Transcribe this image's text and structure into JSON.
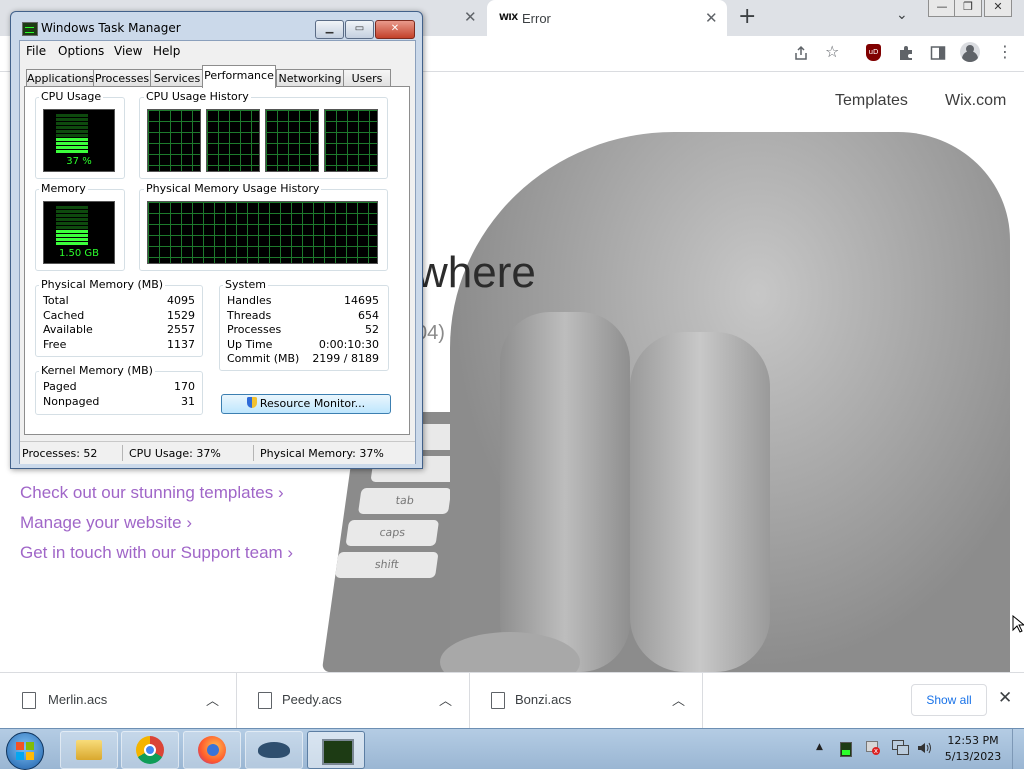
{
  "browser": {
    "tabs": [
      {
        "title": "Error",
        "favicon": "WIX"
      }
    ],
    "new_tab": "+",
    "window_controls": [
      "—",
      "❐",
      "✕"
    ]
  },
  "page": {
    "nav": [
      "Templates",
      "Wix.com"
    ],
    "heading_fragment": "where",
    "subheading_fragment": "04)",
    "links": [
      "Check out our stunning templates ›",
      "Manage your website ›",
      "Get in touch with our Support team ›"
    ],
    "link_color": "#a066c8",
    "keyboard_keys": [
      "tab",
      "caps",
      "shift"
    ]
  },
  "downloads": {
    "items": [
      {
        "name": "Merlin.acs"
      },
      {
        "name": "Peedy.acs"
      },
      {
        "name": "Bonzi.acs"
      }
    ],
    "show_all": "Show all"
  },
  "task_manager": {
    "title": "Windows Task Manager",
    "menu": [
      "File",
      "Options",
      "View",
      "Help"
    ],
    "tabs": [
      "Applications",
      "Processes",
      "Services",
      "Performance",
      "Networking",
      "Users"
    ],
    "active_tab": "Performance",
    "cpu_usage": {
      "label": "CPU Usage",
      "value": "37 %",
      "percent": 37
    },
    "cpu_history": {
      "label": "CPU Usage History"
    },
    "memory": {
      "label": "Memory",
      "value": "1.50 GB",
      "percent": 37
    },
    "memory_history": {
      "label": "Physical Memory Usage History"
    },
    "physical_memory": {
      "label": "Physical Memory (MB)",
      "rows": [
        {
          "name": "Total",
          "value": "4095"
        },
        {
          "name": "Cached",
          "value": "1529"
        },
        {
          "name": "Available",
          "value": "2557"
        },
        {
          "name": "Free",
          "value": "1137"
        }
      ]
    },
    "system": {
      "label": "System",
      "rows": [
        {
          "name": "Handles",
          "value": "14695"
        },
        {
          "name": "Threads",
          "value": "654"
        },
        {
          "name": "Processes",
          "value": "52"
        },
        {
          "name": "Up Time",
          "value": "0:00:10:30"
        },
        {
          "name": "Commit (MB)",
          "value": "2199 / 8189"
        }
      ]
    },
    "kernel_memory": {
      "label": "Kernel Memory (MB)",
      "rows": [
        {
          "name": "Paged",
          "value": "170"
        },
        {
          "name": "Nonpaged",
          "value": "31"
        }
      ]
    },
    "resource_monitor_button": "Resource Monitor...",
    "status": {
      "processes": "Processes: 52",
      "cpu": "CPU Usage: 37%",
      "memory": "Physical Memory: 37%"
    }
  },
  "taskbar": {
    "time": "12:53 PM",
    "date": "5/13/2023"
  }
}
